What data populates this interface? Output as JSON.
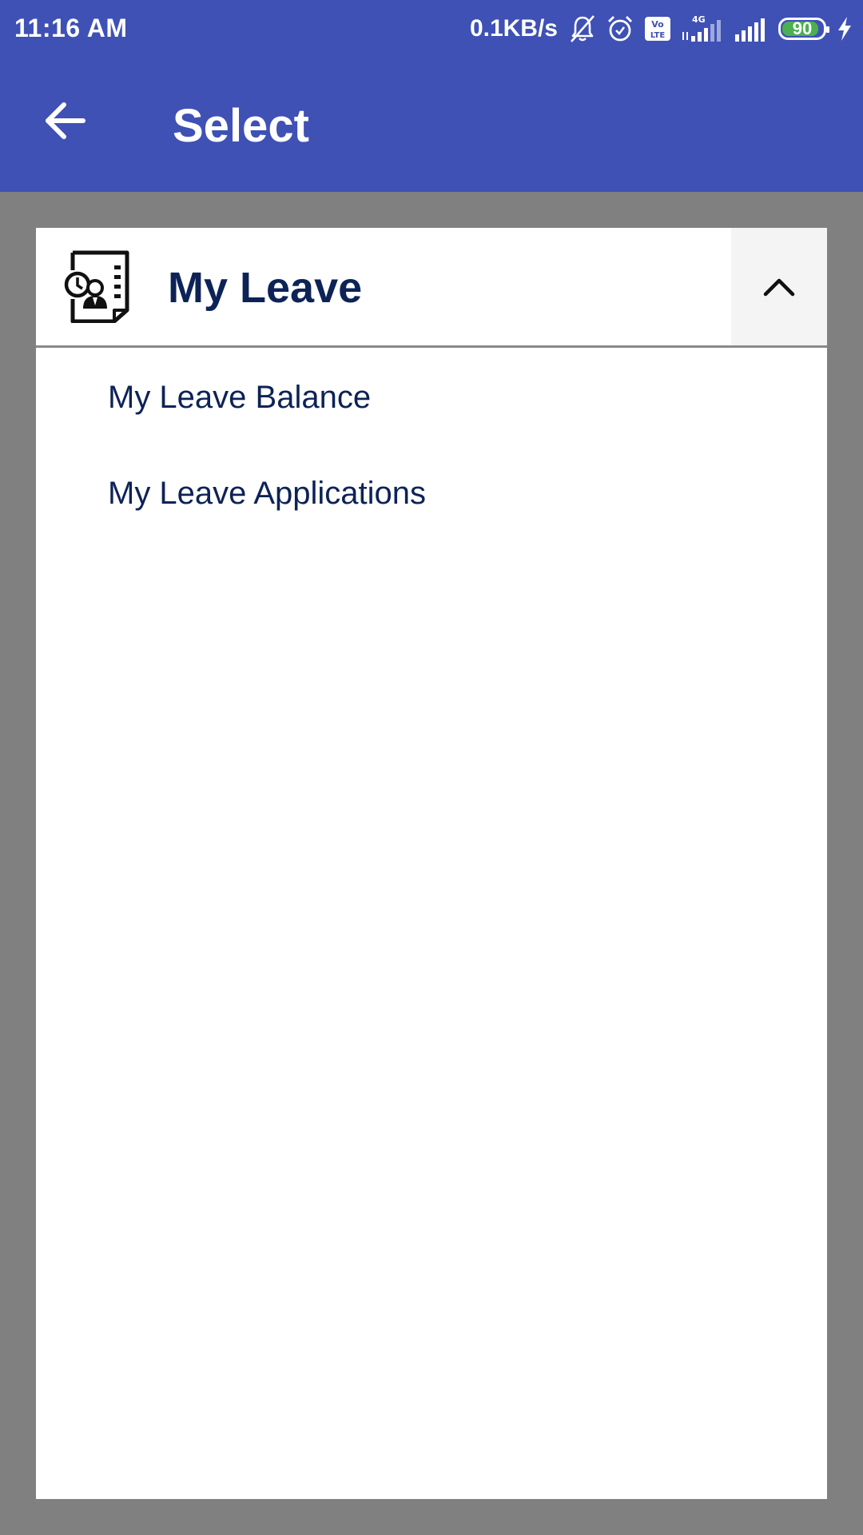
{
  "status_bar": {
    "time": "11:16 AM",
    "net_speed": "0.1KB/s",
    "icons": [
      "bell-off-icon",
      "alarm-icon",
      "volte-icon",
      "signal-4g-icon",
      "signal-icon"
    ],
    "battery_level": "90",
    "battery_fraction": 0.9,
    "battery_color": "#4caf50"
  },
  "toolbar": {
    "title": "Select",
    "back_icon": "arrow-left-icon",
    "background": "#3f51b5"
  },
  "section": {
    "title": "My Leave",
    "icon": "leave-document-icon",
    "expanded_icon": "chevron-up-icon",
    "items": [
      {
        "label": "My Leave Balance"
      },
      {
        "label": "My Leave Applications"
      }
    ]
  },
  "colors": {
    "accent": "#3f51b5",
    "text_primary": "#0d2357",
    "page_background": "#808080"
  }
}
